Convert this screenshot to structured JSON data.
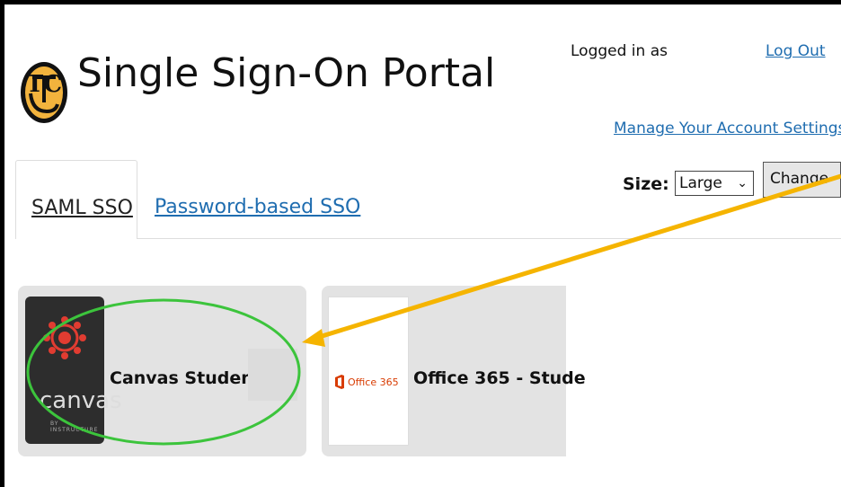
{
  "header": {
    "title": "Single Sign-On Portal",
    "logo_letters": "TC",
    "logged_in_label": "Logged in as",
    "logout_label": "Log Out",
    "manage_label": "Manage Your Account Settings"
  },
  "size_control": {
    "label": "Size:",
    "selected": "Large",
    "button_label": "Change"
  },
  "tabs": [
    {
      "label": "SAML SSO",
      "active": true
    },
    {
      "label": "Password-based SSO",
      "active": false
    }
  ],
  "apps": [
    {
      "name": "Canvas Student",
      "icon": "canvas-logo-icon",
      "logo_text": "canvas",
      "logo_subtext": "BY INSTRUCTURE"
    },
    {
      "name": "Office 365 - Stude",
      "icon": "office365-logo-icon",
      "logo_text": "Office 365"
    }
  ],
  "colors": {
    "link": "#1f6db0",
    "logo_gold": "#f2b33d",
    "annotation_arrow": "#f5b400",
    "annotation_circle": "#3cc43c",
    "tile_bg": "#e3e3e3"
  }
}
